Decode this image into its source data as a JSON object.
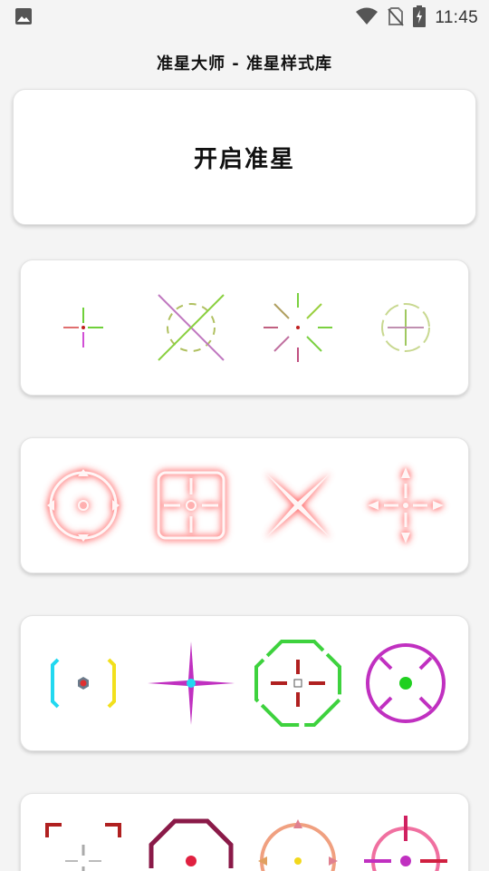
{
  "status_bar": {
    "time": "11:45",
    "icons": [
      "image-icon",
      "wifi-icon",
      "no-sim-icon",
      "battery-charging-icon"
    ]
  },
  "app": {
    "title": "准星大师 - 准星样式库"
  },
  "enable_button": {
    "label": "开启准星"
  },
  "crosshair_rows": [
    {
      "theme": "thin-gradient",
      "items": [
        "thin-cross-crosshair",
        "diagonal-circle-crosshair",
        "starburst-crosshair",
        "dashed-circle-crosshair"
      ]
    },
    {
      "theme": "glow-red",
      "items": [
        "glow-circle-crosshair",
        "glow-square-crosshair",
        "glow-x-crosshair",
        "glow-diamond-crosshair"
      ]
    },
    {
      "theme": "neon",
      "items": [
        "neon-bracket-crosshair",
        "neon-star-crosshair",
        "neon-octagon-crosshair",
        "neon-circle-crosshair"
      ]
    },
    {
      "theme": "bold-color",
      "items": [
        "red-corner-crosshair",
        "maroon-octagon-crosshair",
        "orange-circle-crosshair",
        "magenta-cross-crosshair"
      ]
    }
  ],
  "colors": {
    "glow": "#ff8a8a",
    "neon_green": "#3ed23e",
    "neon_purple": "#c030c0",
    "cyan": "#22d8f0",
    "yellow": "#f2e01c"
  }
}
